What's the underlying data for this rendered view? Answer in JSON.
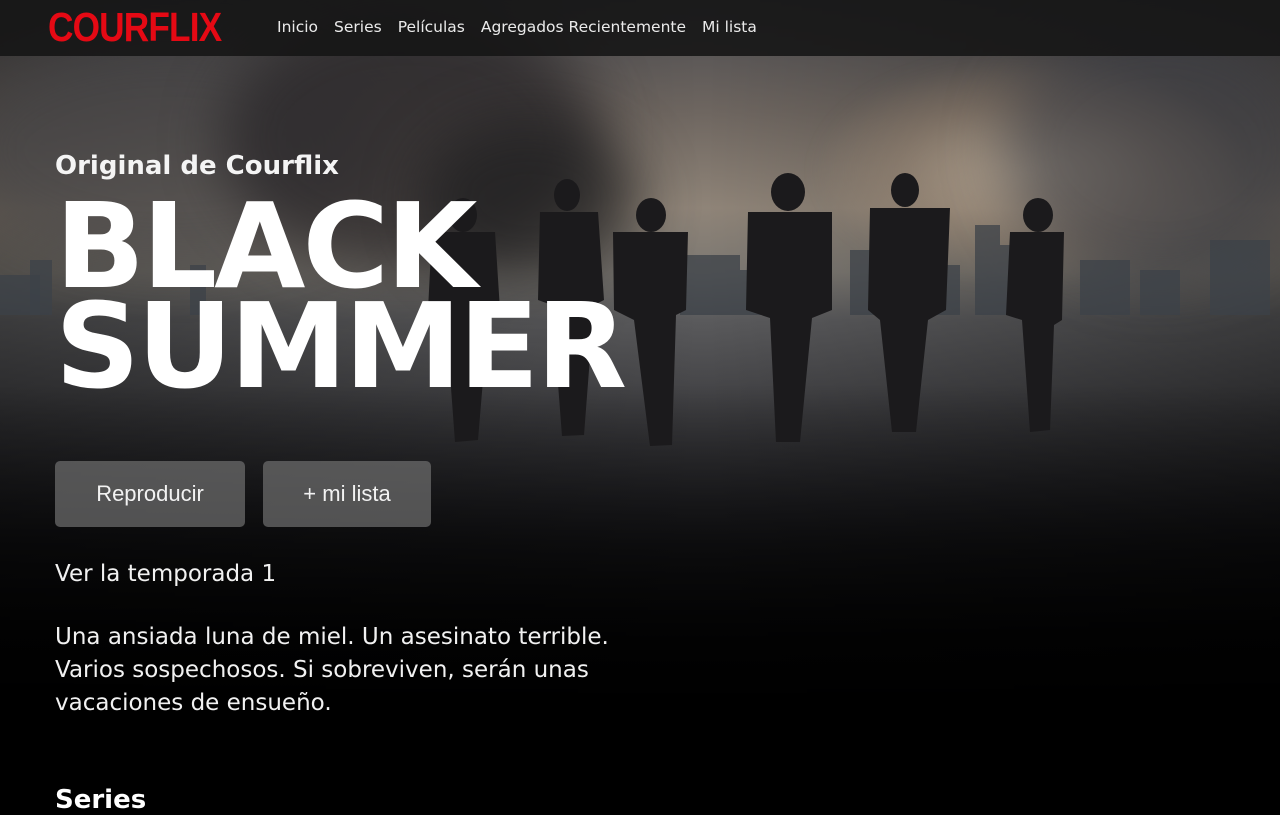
{
  "brand": {
    "logo_text": "COURFLIX",
    "color": "#e50914"
  },
  "nav": {
    "items": [
      {
        "label": "Inicio"
      },
      {
        "label": "Series"
      },
      {
        "label": "Películas"
      },
      {
        "label": "Agregados Recientemente"
      },
      {
        "label": "Mi lista"
      }
    ]
  },
  "hero": {
    "eyebrow": "Original de Courflix",
    "title_line1": "BLACK",
    "title_line2": "SUMMER",
    "play_label": "Reproducir",
    "mylist_label": "+ mi lista",
    "season_label": "Ver la temporada 1",
    "synopsis": "Una ansiada luna de miel. Un asesinato terrible. Varios sospechosos. Si sobreviven, serán unas vacaciones de ensueño."
  },
  "rows": {
    "first_title": "Series"
  }
}
